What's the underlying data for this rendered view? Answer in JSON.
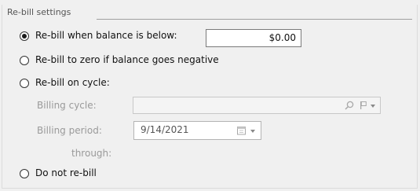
{
  "group": {
    "title": "Re-bill settings"
  },
  "options": {
    "below_balance": {
      "label": "Re-bill when balance is below:",
      "checked": true,
      "amount": "$0.00"
    },
    "to_zero": {
      "label": "Re-bill to zero if balance goes negative",
      "checked": false
    },
    "on_cycle": {
      "label": "Re-bill on cycle:",
      "checked": false,
      "billing_cycle_label": "Billing cycle:",
      "billing_cycle_value": "",
      "billing_period_label": "Billing period:",
      "billing_period_date": "9/14/2021",
      "through_label": "through:"
    },
    "no_rebill": {
      "label": "Do not re-bill",
      "checked": false
    }
  },
  "icons": {
    "search": "search-icon",
    "flag_dropdown": "flag-icon",
    "calendar": "calendar-icon"
  }
}
